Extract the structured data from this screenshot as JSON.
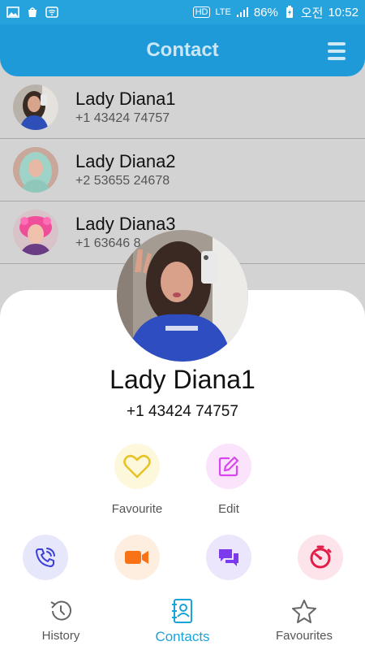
{
  "status_bar": {
    "network_label": "HD",
    "lte_label": "LTE",
    "battery_percent": "86%",
    "ampm": "오전",
    "time": "10:52"
  },
  "app_bar": {
    "title": "Contact"
  },
  "contacts": [
    {
      "name": "Lady Diana1",
      "phone": "+1 43424 74757"
    },
    {
      "name": "Lady Diana2",
      "phone": "+2 53655 24678"
    },
    {
      "name": "Lady Diana3",
      "phone": "+1 63646 8"
    }
  ],
  "detail": {
    "name": "Lady Diana1",
    "phone": "+1 43424 74757",
    "actions_top": [
      {
        "label": "Favourite",
        "icon": "heart-icon",
        "color": "#e8c326"
      },
      {
        "label": "Edit",
        "icon": "edit-icon",
        "color": "#d946ef"
      }
    ],
    "actions_bottom": [
      {
        "icon": "phone-call-icon",
        "color": "#3b3fd6"
      },
      {
        "icon": "video-call-icon",
        "color": "#f97316"
      },
      {
        "icon": "chat-icon",
        "color": "#7c3aed"
      },
      {
        "icon": "timer-icon",
        "color": "#e11d48"
      }
    ]
  },
  "bottom_nav": {
    "items": [
      {
        "label": "History",
        "icon": "history-icon",
        "active": false
      },
      {
        "label": "Contacts",
        "icon": "contacts-icon",
        "active": true
      },
      {
        "label": "Favourites",
        "icon": "star-icon",
        "active": false
      }
    ],
    "active_color": "#1aa3d9"
  }
}
